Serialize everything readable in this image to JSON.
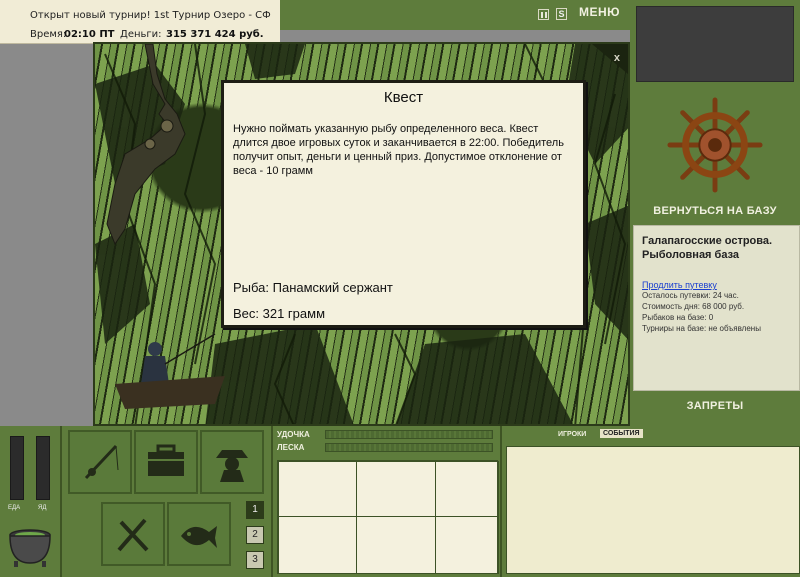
{
  "top_info": {
    "news": "Открыт новый турнир! 1st Турнир Озеро - СФ",
    "time_label": "Время:",
    "time_value": "02:10 ПТ",
    "money_label": "Деньги:",
    "money_value": "315 371 424 руб."
  },
  "topbar": {
    "sound_label": "S",
    "menu_label": "МЕНЮ"
  },
  "game_view": {
    "close_label": "x"
  },
  "quest": {
    "title": "Квест",
    "description": "Нужно поймать указанную рыбу определенного веса. Квест длится двое игровых суток и заканчивается в 22:00. Победитель получит опыт, деньги и ценный приз. Допустимое отклонение от веса - 10 грамм",
    "fish": "Рыба: Панамский сержант",
    "weight": "Вес: 321 грамм"
  },
  "right_panel": {
    "return_label": "ВЕРНУТЬСЯ НА БАЗУ",
    "location": "Галапагосские острова. Рыболовная база",
    "extend_link": "Продлить путевку",
    "stats": [
      "Осталось путевки: 24 час.",
      "Стоимость дня: 68 000 руб.",
      "Рыбаков на базе: 0",
      "Турниры на базе: не объявлены"
    ],
    "bans_label": "ЗАПРЕТЫ"
  },
  "bottom": {
    "eat_label": "ЕДА",
    "yd_label": "ЯД",
    "pages": [
      "1",
      "2",
      "3"
    ],
    "rod_label": "УДОЧКА",
    "line_label": "ЛЕСКА",
    "players_tab": "ИГРОКИ",
    "events_tab": "СОБЫТИЯ"
  },
  "colors": {
    "panel_green": "#5e7c3c",
    "cream": "#f4f1de",
    "link_blue": "#1a3fcf"
  }
}
